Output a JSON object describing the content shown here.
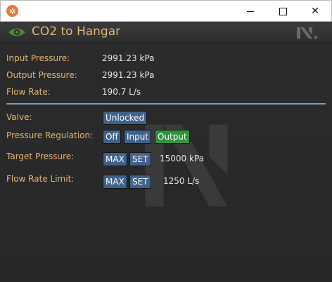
{
  "window": {
    "app_icon": "nanotrasen-icon",
    "controls": [
      "minimize-icon",
      "maximize-icon",
      "close-icon"
    ]
  },
  "header": {
    "title": "CO2 to Hangar",
    "status_icon": "eye-icon",
    "logo": "nanotrasen-logo-icon",
    "title_color": "#e0b879"
  },
  "readouts": [
    {
      "label": "Input Pressure:",
      "value": "2991.23 kPa"
    },
    {
      "label": "Output Pressure:",
      "value": "2991.23 kPa"
    },
    {
      "label": "Flow Rate:",
      "value": "190.7 L/s"
    }
  ],
  "controls": {
    "valve": {
      "label": "Valve:",
      "button": "Unlocked"
    },
    "pressure_regulation": {
      "label": "Pressure Regulation:",
      "options": [
        "Off",
        "Input",
        "Output"
      ],
      "selected": "Output"
    },
    "target_pressure": {
      "label": "Target Pressure:",
      "max": "MAX",
      "set": "SET",
      "value": "15000 kPa"
    },
    "flow_rate_limit": {
      "label": "Flow Rate Limit:",
      "max": "MAX",
      "set": "SET",
      "value": "1250 L/s"
    }
  },
  "colors": {
    "label": "#e3b472",
    "button": "#40628a",
    "button_selected": "#2f943c",
    "divider": "#7a9cc4"
  }
}
